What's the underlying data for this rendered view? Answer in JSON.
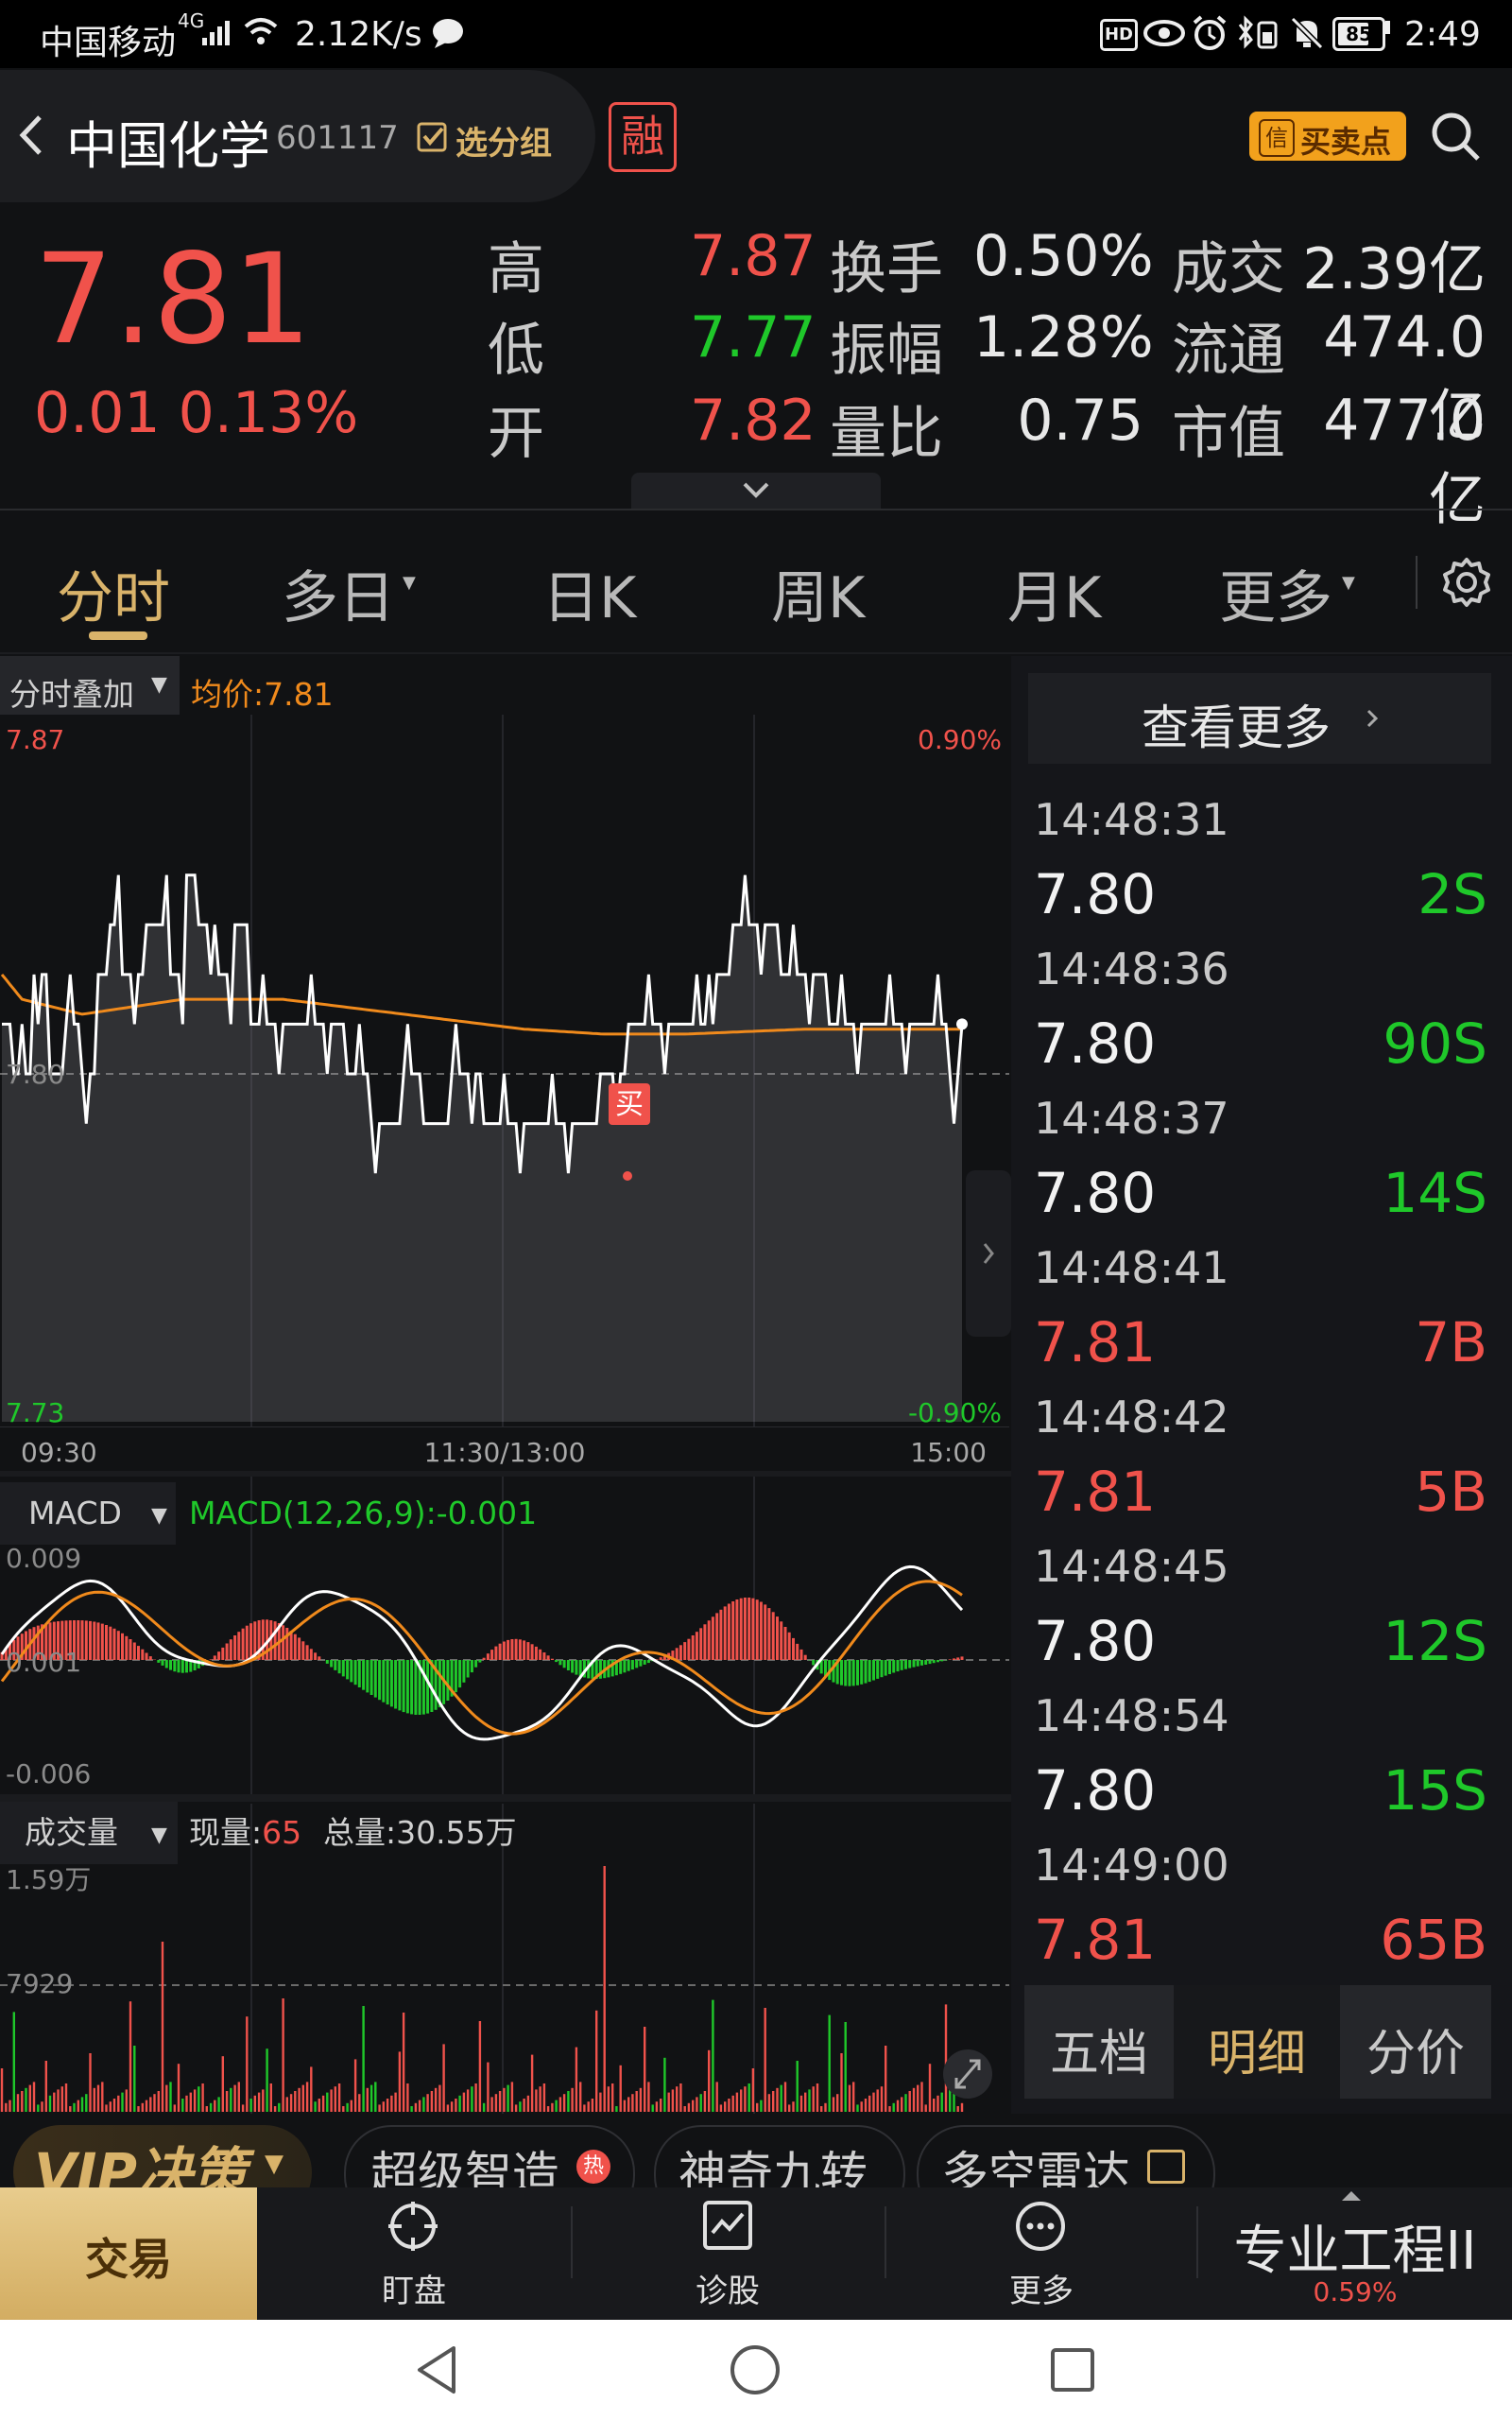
{
  "status_bar": {
    "carrier": "中国移动",
    "network": "4G",
    "speed": "2.12K/s",
    "battery": "85",
    "time": "2:49"
  },
  "header": {
    "stock_name": "中国化学",
    "stock_code": "601117",
    "group_label": "选分组",
    "margin_badge": "融",
    "buy_sell_label": "买卖点",
    "buy_sell_badge": "信"
  },
  "quote": {
    "price": "7.81",
    "change": "0.01 0.13%",
    "rows": [
      {
        "k1": "高",
        "v1": "7.87",
        "k2": "换手",
        "v2": "0.50%",
        "k3": "成交",
        "v3": "2.39亿"
      },
      {
        "k1": "低",
        "v1": "7.77",
        "k2": "振幅",
        "v2": "1.28%",
        "k3": "流通",
        "v3": "474.0亿"
      },
      {
        "k1": "开",
        "v1": "7.82",
        "k2": "量比",
        "v2": "0.75",
        "k3": "市值",
        "v3": "477.0亿"
      }
    ]
  },
  "tabs": [
    "分时",
    "多日",
    "日K",
    "周K",
    "月K",
    "更多"
  ],
  "chart_header": {
    "overlay_label": "分时叠加",
    "avg_price_label": "均价:7.81"
  },
  "price_axis": {
    "top": "7.87",
    "mid": "7.80",
    "bottom": "7.73",
    "top_pct": "0.90%",
    "bottom_pct": "-0.90%",
    "times": [
      "09:30",
      "11:30/13:00",
      "15:00"
    ]
  },
  "buy_marker": "买",
  "macd": {
    "label": "MACD",
    "params": "MACD(12,26,9):-0.001",
    "top": "0.009",
    "mid": "0.001",
    "bottom": "-0.006"
  },
  "volume": {
    "label": "成交量",
    "current_label": "现量:",
    "current_value": "65",
    "total_label": "总量:30.55万",
    "top": "1.59万",
    "mid": "7929"
  },
  "detail": {
    "view_more": "查看更多",
    "ticks": [
      {
        "time": "14:48:31",
        "price": "7.80",
        "vol": "2S",
        "up": false
      },
      {
        "time": "14:48:36",
        "price": "7.80",
        "vol": "90S",
        "up": false
      },
      {
        "time": "14:48:37",
        "price": "7.80",
        "vol": "14S",
        "up": false
      },
      {
        "time": "14:48:41",
        "price": "7.81",
        "vol": "7B",
        "up": true
      },
      {
        "time": "14:48:42",
        "price": "7.81",
        "vol": "5B",
        "up": true
      },
      {
        "time": "14:48:45",
        "price": "7.80",
        "vol": "12S",
        "up": false
      },
      {
        "time": "14:48:54",
        "price": "7.80",
        "vol": "15S",
        "up": false
      },
      {
        "time": "14:49:00",
        "price": "7.81",
        "vol": "65B",
        "up": true
      }
    ],
    "tabs": [
      "五档",
      "明细",
      "分价"
    ]
  },
  "feature_strip": [
    "VIP决策",
    "超级智造",
    "神奇九转",
    "多空雷达"
  ],
  "hot_badge": "热",
  "bottom_bar": {
    "trade": "交易",
    "items": [
      "盯盘",
      "诊股",
      "更多"
    ],
    "pro_title": "专业工程II",
    "pro_pct": "0.59%"
  },
  "colors": {
    "up": "#f0524b",
    "down": "#1fc82a",
    "avg_line": "#f08a1c",
    "price_line": "#ffffff",
    "gold": "#d9b36a"
  }
}
